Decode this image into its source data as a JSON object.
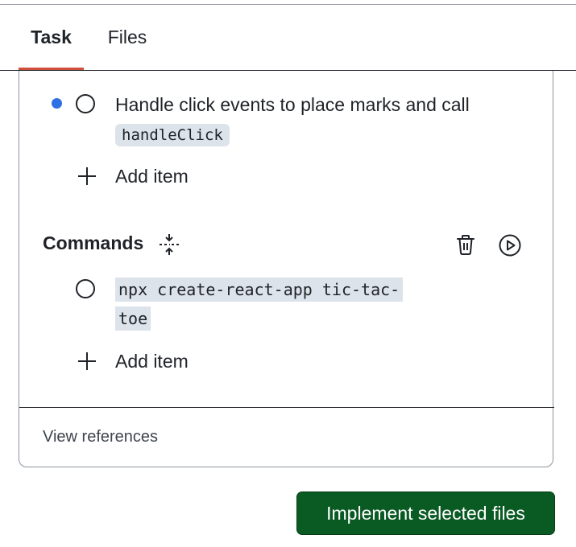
{
  "tabs": [
    {
      "label": "Task",
      "active": true
    },
    {
      "label": "Files",
      "active": false
    }
  ],
  "tasks": {
    "items": [
      {
        "text": "Handle click events to place marks and call ",
        "code": "handleClick",
        "checked": false,
        "indicator": "unsaved-dot"
      }
    ],
    "add_item_label": "Add item"
  },
  "commands": {
    "title": "Commands",
    "items": [
      {
        "code": "npx create-react-app tic-tac-toe",
        "checked": false
      }
    ],
    "add_item_label": "Add item"
  },
  "footer": {
    "view_references_label": "View references"
  },
  "actions": {
    "implement_label": "Implement selected files"
  },
  "icons": {
    "collapse": "collapse-vertical-icon",
    "trash": "trash-icon",
    "run": "play-circle-icon",
    "plus": "plus-icon",
    "checkbox": "circle-icon"
  },
  "colors": {
    "accent_underline": "#cf4f3a",
    "primary_button": "#0a5a23",
    "unsaved_dot": "#2f6fe4",
    "code_background": "#dde3ea"
  }
}
